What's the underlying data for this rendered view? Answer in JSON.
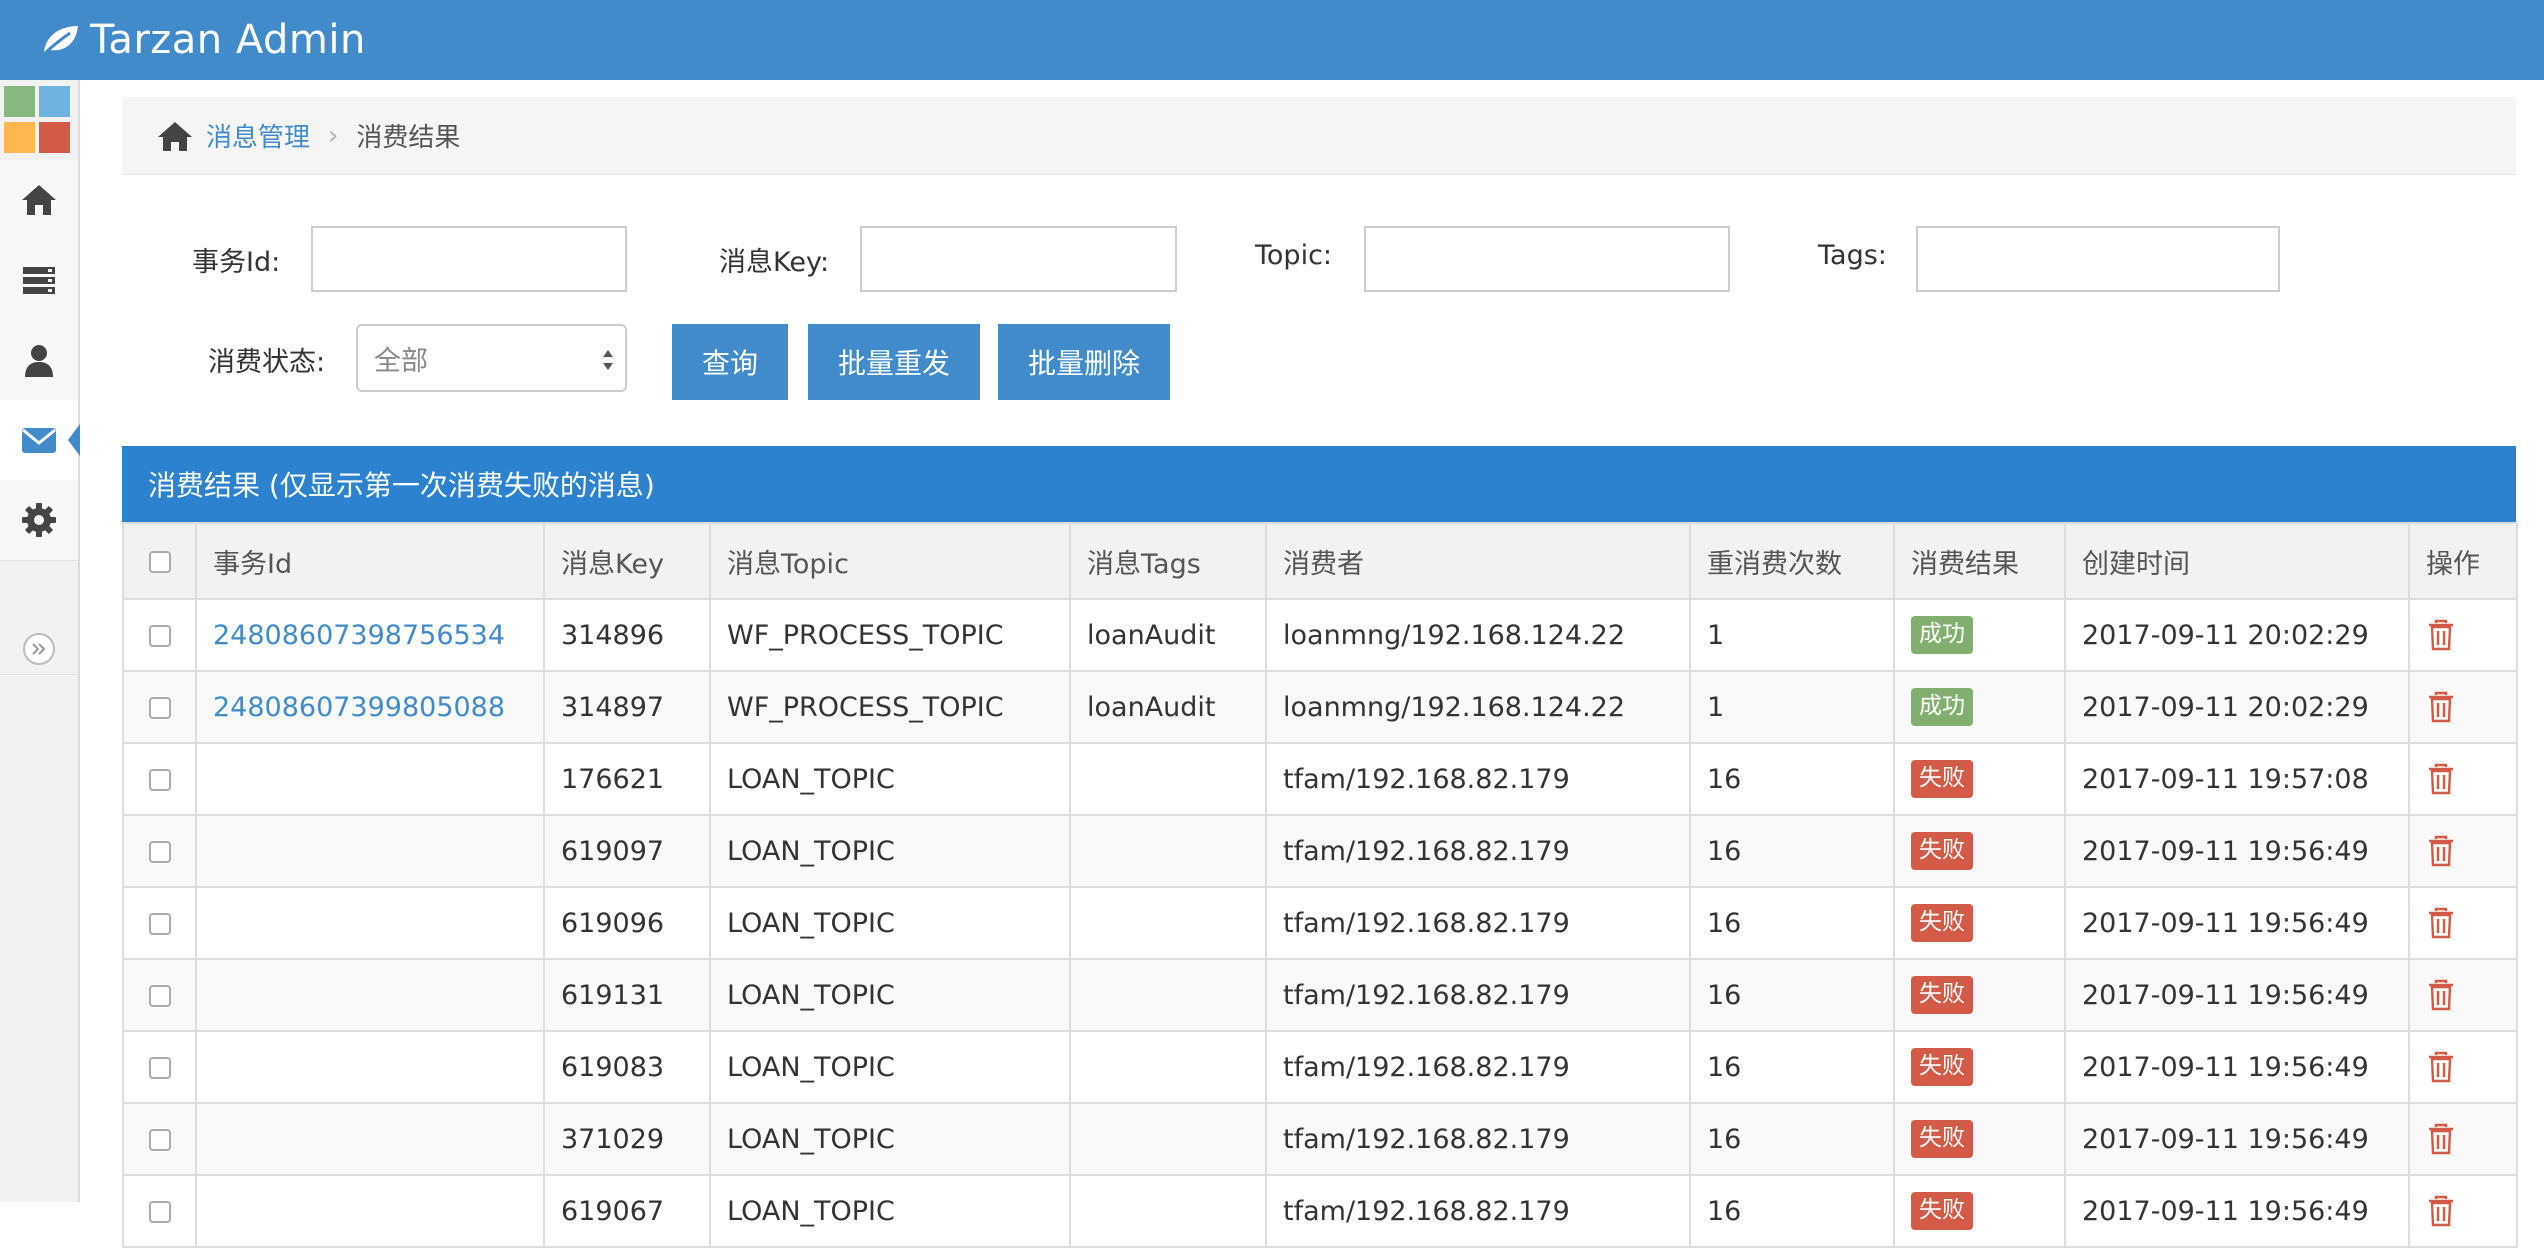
{
  "app": {
    "title": "Tarzan Admin"
  },
  "sidebar": {
    "shortcut_colors": [
      "#87b87f",
      "#6fb3e0",
      "#ffb752",
      "#d15b47"
    ],
    "items": [
      {
        "icon": "home-icon"
      },
      {
        "icon": "server-icon"
      },
      {
        "icon": "user-icon"
      },
      {
        "icon": "envelope-icon",
        "active": true
      },
      {
        "icon": "gear-icon"
      }
    ]
  },
  "breadcrumb": {
    "parent": "消息管理",
    "current": "消费结果"
  },
  "filters": {
    "tx_id_label": "事务Id:",
    "msg_key_label": "消息Key:",
    "topic_label": "Topic:",
    "tags_label": "Tags:",
    "status_label": "消费状态:",
    "status_value": "全部",
    "tx_id_value": "",
    "msg_key_value": "",
    "topic_value": "",
    "tags_value": ""
  },
  "buttons": {
    "query": "查询",
    "batch_resend": "批量重发",
    "batch_delete": "批量删除"
  },
  "panel": {
    "title": "消费结果 (仅显示第一次消费失败的消息)"
  },
  "table": {
    "headers": [
      "事务Id",
      "消息Key",
      "消息Topic",
      "消息Tags",
      "消费者",
      "重消费次数",
      "消费结果",
      "创建时间",
      "操作"
    ],
    "rows": [
      {
        "tx_id": "24808607398756534",
        "key": "314896",
        "topic": "WF_PROCESS_TOPIC",
        "tags": "loanAudit",
        "consumer": "loanmng/192.168.124.22",
        "retry": "1",
        "result": "成功",
        "status": "success",
        "created": "2017-09-11 20:02:29"
      },
      {
        "tx_id": "24808607399805088",
        "key": "314897",
        "topic": "WF_PROCESS_TOPIC",
        "tags": "loanAudit",
        "consumer": "loanmng/192.168.124.22",
        "retry": "1",
        "result": "成功",
        "status": "success",
        "created": "2017-09-11 20:02:29"
      },
      {
        "tx_id": "",
        "key": "176621",
        "topic": "LOAN_TOPIC",
        "tags": "",
        "consumer": "tfam/192.168.82.179",
        "retry": "16",
        "result": "失败",
        "status": "fail",
        "created": "2017-09-11 19:57:08"
      },
      {
        "tx_id": "",
        "key": "619097",
        "topic": "LOAN_TOPIC",
        "tags": "",
        "consumer": "tfam/192.168.82.179",
        "retry": "16",
        "result": "失败",
        "status": "fail",
        "created": "2017-09-11 19:56:49"
      },
      {
        "tx_id": "",
        "key": "619096",
        "topic": "LOAN_TOPIC",
        "tags": "",
        "consumer": "tfam/192.168.82.179",
        "retry": "16",
        "result": "失败",
        "status": "fail",
        "created": "2017-09-11 19:56:49"
      },
      {
        "tx_id": "",
        "key": "619131",
        "topic": "LOAN_TOPIC",
        "tags": "",
        "consumer": "tfam/192.168.82.179",
        "retry": "16",
        "result": "失败",
        "status": "fail",
        "created": "2017-09-11 19:56:49"
      },
      {
        "tx_id": "",
        "key": "619083",
        "topic": "LOAN_TOPIC",
        "tags": "",
        "consumer": "tfam/192.168.82.179",
        "retry": "16",
        "result": "失败",
        "status": "fail",
        "created": "2017-09-11 19:56:49"
      },
      {
        "tx_id": "",
        "key": "371029",
        "topic": "LOAN_TOPIC",
        "tags": "",
        "consumer": "tfam/192.168.82.179",
        "retry": "16",
        "result": "失败",
        "status": "fail",
        "created": "2017-09-11 19:56:49"
      },
      {
        "tx_id": "",
        "key": "619067",
        "topic": "LOAN_TOPIC",
        "tags": "",
        "consumer": "tfam/192.168.82.179",
        "retry": "16",
        "result": "失败",
        "status": "fail",
        "created": "2017-09-11 19:56:49"
      }
    ]
  },
  "colors": {
    "primary": "#428bca",
    "panel_header": "#2d82cf",
    "success": "#82af6f",
    "danger": "#d15b47"
  }
}
